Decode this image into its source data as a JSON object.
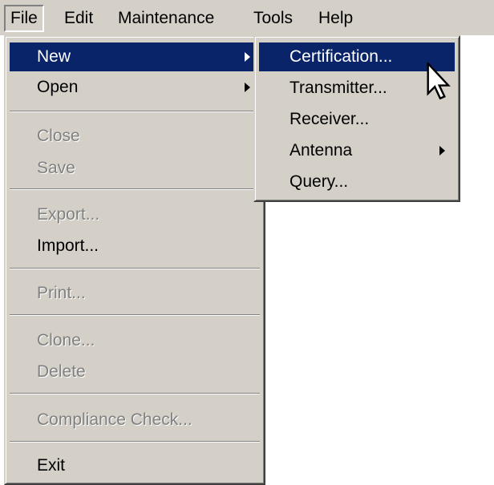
{
  "menubar": {
    "file": "File",
    "edit": "Edit",
    "maintenance": "Maintenance",
    "tools": "Tools",
    "help": "Help"
  },
  "file_menu": {
    "new": "New",
    "open": "Open",
    "close": "Close",
    "save": "Save",
    "export": "Export...",
    "import": "Import...",
    "print": "Print...",
    "clone": "Clone...",
    "delete": "Delete",
    "compliance_check": "Compliance Check...",
    "exit": "Exit"
  },
  "new_submenu": {
    "certification": "Certification...",
    "transmitter": "Transmitter...",
    "receiver": "Receiver...",
    "antenna": "Antenna",
    "query": "Query..."
  },
  "colors": {
    "menu_bg": "#d4d0c8",
    "highlight": "#0a246a",
    "disabled_text": "#808080"
  },
  "icons": [
    "submenu-arrow-icon",
    "mouse-pointer-icon"
  ]
}
